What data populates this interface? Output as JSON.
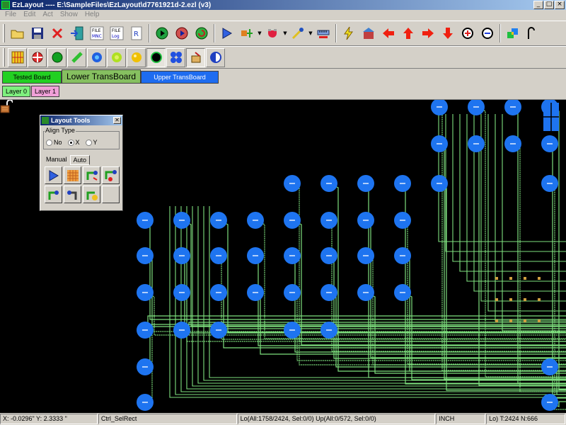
{
  "window": {
    "title": "EzLayout ---- E:\\SampleFiles\\EzLayout\\d7761921d-2.ezl (v3)"
  },
  "menu": [
    "File",
    "Edit",
    "Act",
    "Show",
    "Help"
  ],
  "toolbar1": {
    "file_mnc_label": "FILE\nMNC",
    "file_log_label": "FILE\nLog",
    "r_label": "R"
  },
  "board_tabs": [
    "Tested Board",
    "Lower TransBoard",
    "Upper TransBoard"
  ],
  "layer_tabs": [
    "Layer 0",
    "Layer 1"
  ],
  "layout_tools": {
    "title": "Layout Tools",
    "close": "✕",
    "align_type_label": "Align Type",
    "options": [
      "No",
      "X",
      "Y"
    ],
    "selected_option": "X",
    "tabs": [
      "Manual",
      "Auto"
    ],
    "active_tab": "Auto"
  },
  "status": {
    "coords": "X: -0.0296\"  Y:  2.3333 \"",
    "mode": "Ctrl_SelRect",
    "counts": "Lo(All:1758/2424, Sel:0/0)  Up(All:0/572, Sel:0/0)",
    "units": "INCH",
    "totals": "Lo) T:2424 N:666"
  },
  "colors": {
    "pad": "#1e74f0",
    "trace": "#7ee07e",
    "canvas": "#000000",
    "tested": "#22d022",
    "lower": "#86c060",
    "upper": "#1e6cf0"
  }
}
